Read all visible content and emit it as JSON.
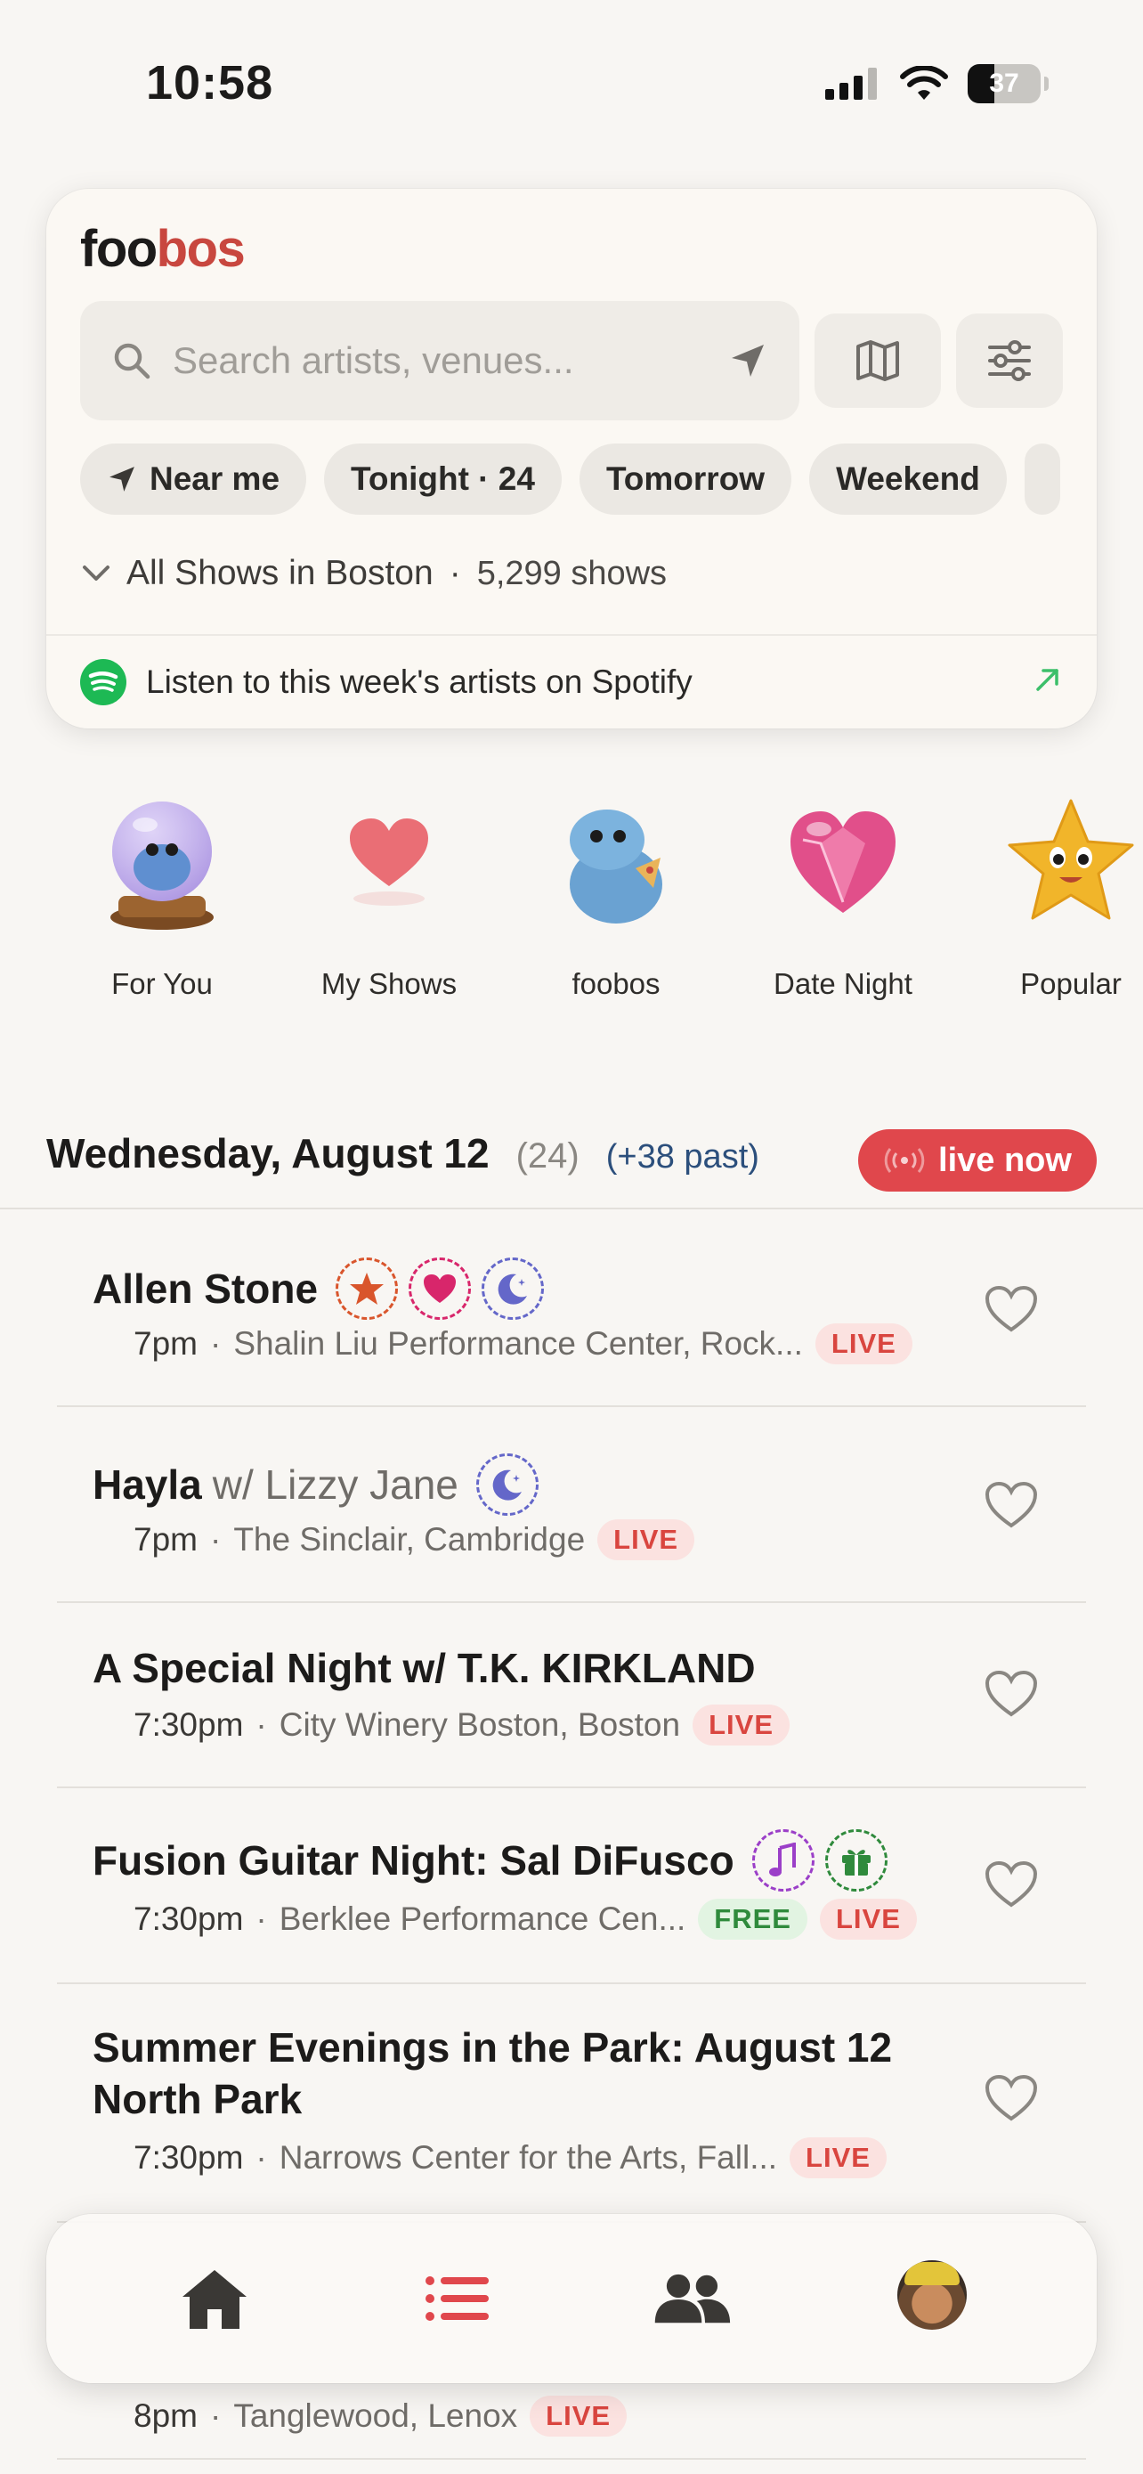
{
  "status_bar": {
    "time": "10:58",
    "battery": "37",
    "battery_level": 0.37
  },
  "header": {
    "logo_part1": "foo",
    "logo_part2": "bos",
    "search_placeholder": "Search artists, venues...",
    "chips": [
      "Near me",
      "Tonight · 24",
      "Tomorrow",
      "Weekend"
    ],
    "all_shows_label": "All Shows in Boston",
    "all_shows_sep": "·",
    "all_shows_count": "5,299 shows",
    "spotify_label": "Listen to this week's artists on Spotify"
  },
  "categories": [
    {
      "label": "For You",
      "icon": "crystal-ball-icon"
    },
    {
      "label": "My Shows",
      "icon": "heart-icon"
    },
    {
      "label": "foobos",
      "icon": "mascot-icon"
    },
    {
      "label": "Date Night",
      "icon": "gem-heart-icon"
    },
    {
      "label": "Popular",
      "icon": "star-face-icon"
    }
  ],
  "date_header": {
    "date": "Wednesday, August 12",
    "count": "(24)",
    "past": "(+38 past)",
    "live_now": "live now"
  },
  "events": [
    {
      "title": "Allen Stone",
      "with": "",
      "time": "7pm",
      "venue": "Shalin Liu Performance Center, Rock...",
      "badges": [
        "LIVE"
      ],
      "tags": [
        "star-tag-icon",
        "heart-tag-icon",
        "moon-tag-icon"
      ]
    },
    {
      "title": "Hayla",
      "with": "w/ Lizzy Jane",
      "time": "7pm",
      "venue": "The Sinclair, Cambridge",
      "badges": [
        "LIVE"
      ],
      "tags": [
        "moon-tag-icon"
      ]
    },
    {
      "title": "A Special Night w/ T.K. KIRKLAND",
      "with": "",
      "time": "7:30pm",
      "venue": "City Winery Boston, Boston",
      "badges": [
        "LIVE"
      ],
      "tags": []
    },
    {
      "title": "Fusion Guitar Night: Sal DiFusco",
      "with": "",
      "time": "7:30pm",
      "venue": "Berklee Performance Cen...",
      "badges": [
        "FREE",
        "LIVE"
      ],
      "tags": [
        "music-tag-icon",
        "gift-tag-icon"
      ]
    },
    {
      "title": "Summer Evenings in the Park: August 12 North Park",
      "with": "",
      "time": "7:30pm",
      "venue": "Narrows Center for the Arts, Fall...",
      "badges": [
        "LIVE"
      ],
      "tags": []
    },
    {
      "title": "",
      "with": "",
      "time": "8pm",
      "venue": "Tanglewood, Lenox",
      "badges": [
        "LIVE"
      ],
      "tags": []
    }
  ],
  "meta_sep": "·",
  "tab_bar": [
    "home-icon",
    "list-icon",
    "people-icon",
    "profile-avatar"
  ],
  "colors": {
    "accent": "#e0474c",
    "logo_red": "#c8473f",
    "live_bg": "#fbe2e0",
    "free_bg": "#e2f4e2",
    "spotify": "#1db954"
  }
}
